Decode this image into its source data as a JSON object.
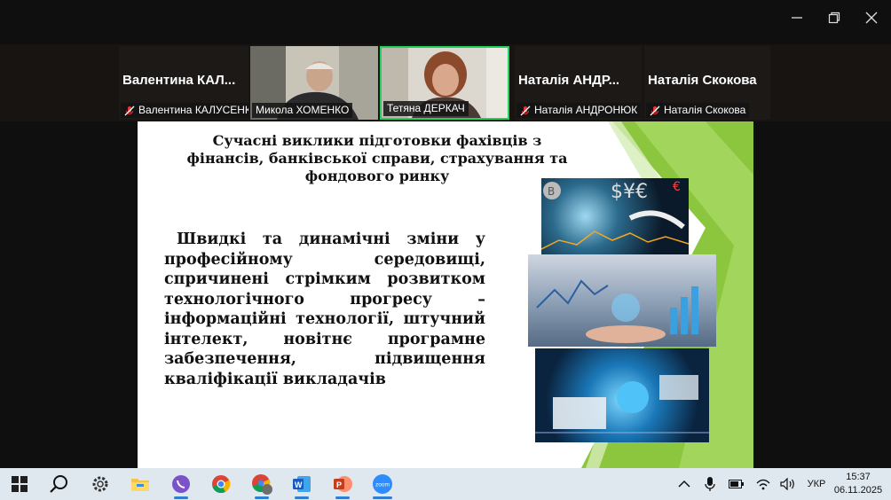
{
  "window_controls": {
    "minimize_icon": "minimize-icon",
    "restore_icon": "restore-icon",
    "close_icon": "close-icon"
  },
  "participants": [
    {
      "display_name": "Валентина  КАЛ...",
      "tag": "Валентина КАЛУСЕНКО",
      "muted": true,
      "video": false
    },
    {
      "display_name": "",
      "tag": "Микола ХОМЕНКО",
      "muted": false,
      "video": true
    },
    {
      "display_name": "",
      "tag": "Тетяна ДЕРКАЧ",
      "muted": false,
      "video": true,
      "active_speaker": true
    },
    {
      "display_name": "Наталія  АНДР...",
      "tag": "Наталія АНДРОНЮК",
      "muted": true,
      "video": false
    },
    {
      "display_name": "Наталія  Скокова",
      "tag": "Наталія Скокова",
      "muted": true,
      "video": false
    }
  ],
  "slide": {
    "title": "Сучасні виклики підготовки фахівців з фінансів, банківської справи, страхування та фондового ринку",
    "body": "Швидкі та динамічні зміни у професійному середовищі, спричинені стрімким розвитком технологічного прогресу – інформаційні технології, штучний інтелект, новітнє програмне забезпечення, підвищення кваліфікації викладачів",
    "accent_color": "#8cc63f"
  },
  "taskbar": {
    "apps": [
      "windows-start-icon",
      "search-icon",
      "settings-icon",
      "file-explorer-icon",
      "viber-icon",
      "chrome-icon",
      "chrome-profile-icon",
      "word-icon",
      "powerpoint-icon",
      "zoom-icon"
    ],
    "tray": {
      "language": "УКР",
      "time": "15:37",
      "date": "06.11.2025"
    }
  }
}
